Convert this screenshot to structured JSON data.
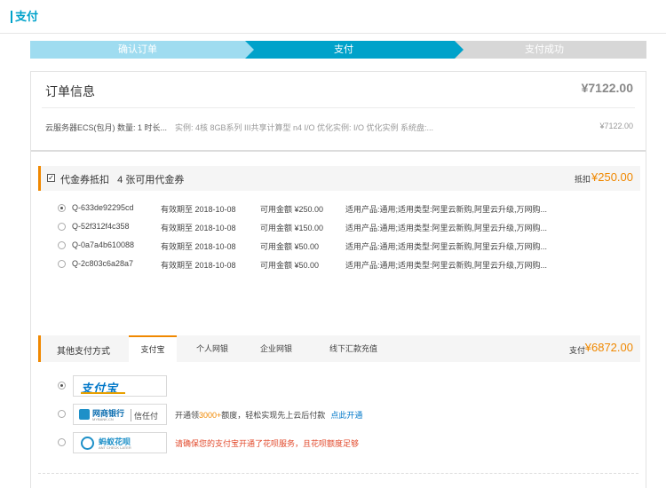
{
  "header": {
    "title": "支付"
  },
  "steps": [
    {
      "label": "确认订单",
      "state": "done"
    },
    {
      "label": "支付",
      "state": "active"
    },
    {
      "label": "支付成功",
      "state": "pending"
    }
  ],
  "order": {
    "heading": "订单信息",
    "total": "¥7122.00",
    "product": {
      "name": "云服务器ECS(包月) 数量: 1 时长...",
      "spec": "实例: 4核 8GB系列 III共享计算型 n4 I/O 优化实例: I/O 优化实例 系统盘:...",
      "price": "¥7122.00"
    }
  },
  "coupon": {
    "checked": true,
    "label": "代金券抵扣",
    "available_text": "4 张可用代金券",
    "deduct_label": "抵扣",
    "deduct_amount": "¥250.00",
    "rows": [
      {
        "id": "Q-633de92295cd",
        "expiry": "有效期至 2018-10-08",
        "amount": "可用金额 ¥250.00",
        "scope": "适用产品:通用;适用类型:阿里云新购,阿里云升级,万网购...",
        "selected": true
      },
      {
        "id": "Q-52f312f4c358",
        "expiry": "有效期至 2018-10-08",
        "amount": "可用金额 ¥150.00",
        "scope": "适用产品:通用;适用类型:阿里云新购,阿里云升级,万网购...",
        "selected": false
      },
      {
        "id": "Q-0a7a4b610088",
        "expiry": "有效期至 2018-10-08",
        "amount": "可用金额 ¥50.00",
        "scope": "适用产品:通用;适用类型:阿里云新购,阿里云升级,万网购...",
        "selected": false
      },
      {
        "id": "Q-2c803c6a28a7",
        "expiry": "有效期至 2018-10-08",
        "amount": "可用金额 ¥50.00",
        "scope": "适用产品:通用;适用类型:阿里云新购,阿里云升级,万网购...",
        "selected": false
      }
    ]
  },
  "payment": {
    "other_label": "其他支付方式",
    "tabs": [
      {
        "label": "支付宝",
        "active": true
      },
      {
        "label": "个人网银",
        "active": false
      },
      {
        "label": "企业网银",
        "active": false
      },
      {
        "label": "线下汇款充值",
        "active": false
      }
    ],
    "pay_label": "支付",
    "pay_amount": "¥6872.00",
    "options": [
      {
        "logo": "支付宝",
        "selected": true
      },
      {
        "logo": "网商银行",
        "logo_sub": "MYBANK.CN",
        "logo_extra": "信任付",
        "selected": false,
        "note_prefix": "开通领",
        "note_highlight": "3000+",
        "note_suffix": "额度，轻松实现先上云后付款",
        "note_link": "点此开通"
      },
      {
        "logo": "蚂蚁花呗",
        "logo_sub": "ANT CHECK LATER",
        "selected": false,
        "warning": "请确保您的支付宝开通了花呗服务，且花呗额度足够"
      }
    ]
  },
  "colors": {
    "accent": "#00a2ca",
    "orange": "#f08800",
    "step_done": "#9fdcf0",
    "step_pending": "#d7d7d7"
  }
}
